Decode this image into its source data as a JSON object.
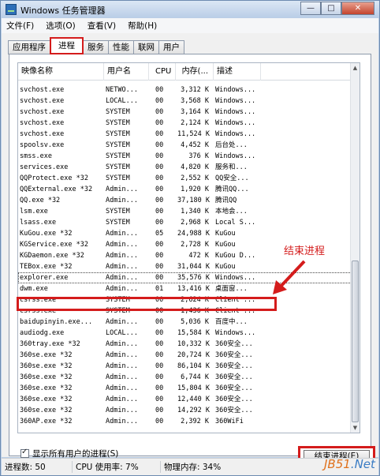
{
  "window": {
    "title": "Windows 任务管理器",
    "buttons": {
      "minimize": "—",
      "maximize": "□",
      "close": "✕"
    }
  },
  "menu": [
    "文件(F)",
    "选项(O)",
    "查看(V)",
    "帮助(H)"
  ],
  "tabs": [
    "应用程序",
    "进程",
    "服务",
    "性能",
    "联网",
    "用户"
  ],
  "active_tab": "进程",
  "columns": [
    "映像名称",
    "用户名",
    "CPU",
    "内存(...",
    "描述"
  ],
  "processes": [
    [
      "svchost.exe",
      "NETWO...",
      "00",
      "3,312 K",
      "Windows..."
    ],
    [
      "svchost.exe",
      "LOCAL...",
      "00",
      "3,568 K",
      "Windows..."
    ],
    [
      "svchost.exe",
      "SYSTEM",
      "00",
      "3,164 K",
      "Windows..."
    ],
    [
      "svchost.exe",
      "SYSTEM",
      "00",
      "2,124 K",
      "Windows..."
    ],
    [
      "svchost.exe",
      "SYSTEM",
      "00",
      "11,524 K",
      "Windows..."
    ],
    [
      "spoolsv.exe",
      "SYSTEM",
      "00",
      "4,452 K",
      "后台处..."
    ],
    [
      "smss.exe",
      "SYSTEM",
      "00",
      "376 K",
      "Windows..."
    ],
    [
      "services.exe",
      "SYSTEM",
      "00",
      "4,820 K",
      "服务和..."
    ],
    [
      "QQProtect.exe *32",
      "SYSTEM",
      "00",
      "2,552 K",
      "QQ安全..."
    ],
    [
      "QQExternal.exe *32",
      "Admin...",
      "00",
      "1,920 K",
      "腾讯QQ..."
    ],
    [
      "QQ.exe *32",
      "Admin...",
      "00",
      "37,180 K",
      "腾讯QQ"
    ],
    [
      "lsm.exe",
      "SYSTEM",
      "00",
      "1,340 K",
      "本地会..."
    ],
    [
      "lsass.exe",
      "SYSTEM",
      "00",
      "2,968 K",
      "Local S..."
    ],
    [
      "KuGou.exe *32",
      "Admin...",
      "05",
      "24,988 K",
      "KuGou"
    ],
    [
      "KGService.exe *32",
      "Admin...",
      "00",
      "2,728 K",
      "KuGou"
    ],
    [
      "KGDaemon.exe *32",
      "Admin...",
      "00",
      "472 K",
      "KuGou D..."
    ],
    [
      "TEBox.exe *32",
      "Admin...",
      "00",
      "31,044 K",
      "KuGou"
    ],
    [
      "explorer.exe",
      "Admin...",
      "00",
      "35,576 K",
      "Windows..."
    ],
    [
      "dwm.exe",
      "Admin...",
      "01",
      "13,416 K",
      "桌面窗..."
    ],
    [
      "csrss.exe",
      "SYSTEM",
      "00",
      "2,624 K",
      "Client ..."
    ],
    [
      "csrss.exe",
      "SYSTEM",
      "00",
      "1,436 K",
      "Client ..."
    ],
    [
      "baidupinyin.exe...",
      "Admin...",
      "00",
      "5,036 K",
      "百度中..."
    ],
    [
      "audiodg.exe",
      "LOCAL...",
      "00",
      "15,584 K",
      "Windows..."
    ],
    [
      "360tray.exe *32",
      "Admin...",
      "00",
      "10,332 K",
      "360安全..."
    ],
    [
      "360se.exe *32",
      "Admin...",
      "00",
      "20,724 K",
      "360安全..."
    ],
    [
      "360se.exe *32",
      "Admin...",
      "00",
      "86,104 K",
      "360安全..."
    ],
    [
      "360se.exe *32",
      "Admin...",
      "00",
      "6,744 K",
      "360安全..."
    ],
    [
      "360se.exe *32",
      "Admin...",
      "00",
      "15,804 K",
      "360安全..."
    ],
    [
      "360se.exe *32",
      "Admin...",
      "00",
      "12,440 K",
      "360安全..."
    ],
    [
      "360se.exe *32",
      "Admin...",
      "00",
      "14,292 K",
      "360安全..."
    ],
    [
      "360AP.exe *32",
      "Admin...",
      "00",
      "2,392 K",
      "360WiFi"
    ]
  ],
  "selected_index": 17,
  "annotation": "结束进程",
  "show_all_label": "显示所有用户的进程(S)",
  "show_all_checked": true,
  "end_button": "结束进程(E)",
  "status": {
    "processes": "进程数: 50",
    "cpu": "CPU 使用率: 7%",
    "memory": "物理内存: 34%"
  },
  "watermark": {
    "brand": "JB51",
    "suffix": ".Net"
  },
  "colors": {
    "annotation": "#d41c1c",
    "accent": "#2d6fb7"
  }
}
